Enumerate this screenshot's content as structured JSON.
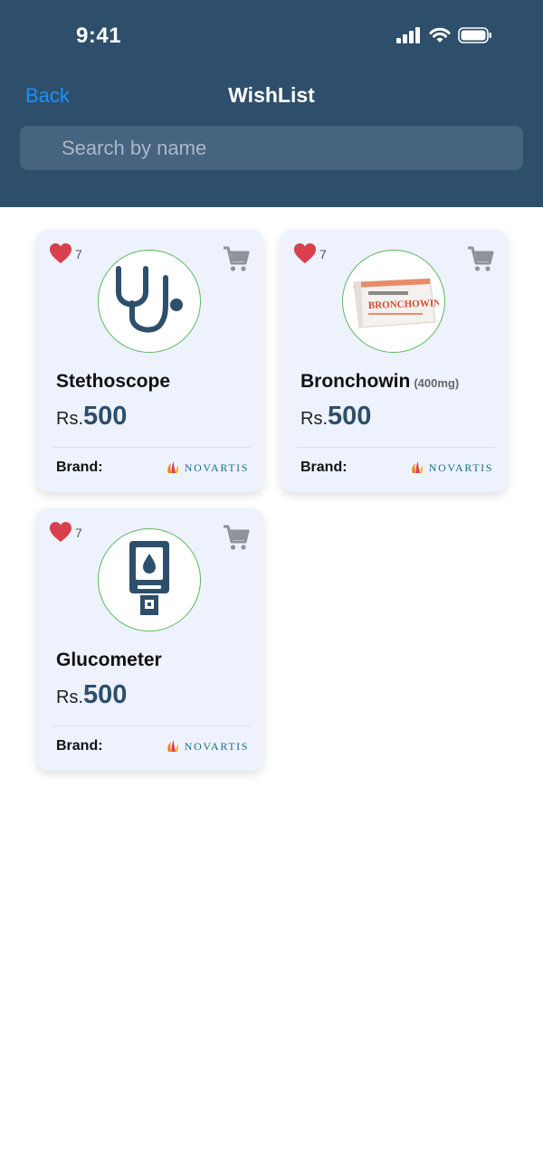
{
  "status_bar": {
    "time": "9:41"
  },
  "header": {
    "back_label": "Back",
    "title": "WishList"
  },
  "search": {
    "placeholder": "Search by name"
  },
  "colors": {
    "header_bg": "#2e4f6b",
    "accent": "#1f8fff",
    "heart": "#d9404e",
    "card_bg": "#edf2fd",
    "price": "#2e4f6b"
  },
  "products": [
    {
      "name": "Stethoscope",
      "dosage": "",
      "likes": "7",
      "currency": "Rs.",
      "price": "500",
      "brand_label": "Brand:",
      "brand": "NOVARTIS",
      "icon": "stethoscope-icon"
    },
    {
      "name": "Bronchowin",
      "dosage": "(400mg)",
      "likes": "7",
      "currency": "Rs.",
      "price": "500",
      "brand_label": "Brand:",
      "brand": "NOVARTIS",
      "icon": "medicine-box-image",
      "package_text": "BRONCHOWIN"
    },
    {
      "name": "Glucometer",
      "dosage": "",
      "likes": "7",
      "currency": "Rs.",
      "price": "500",
      "brand_label": "Brand:",
      "brand": "NOVARTIS",
      "icon": "glucometer-icon"
    }
  ]
}
